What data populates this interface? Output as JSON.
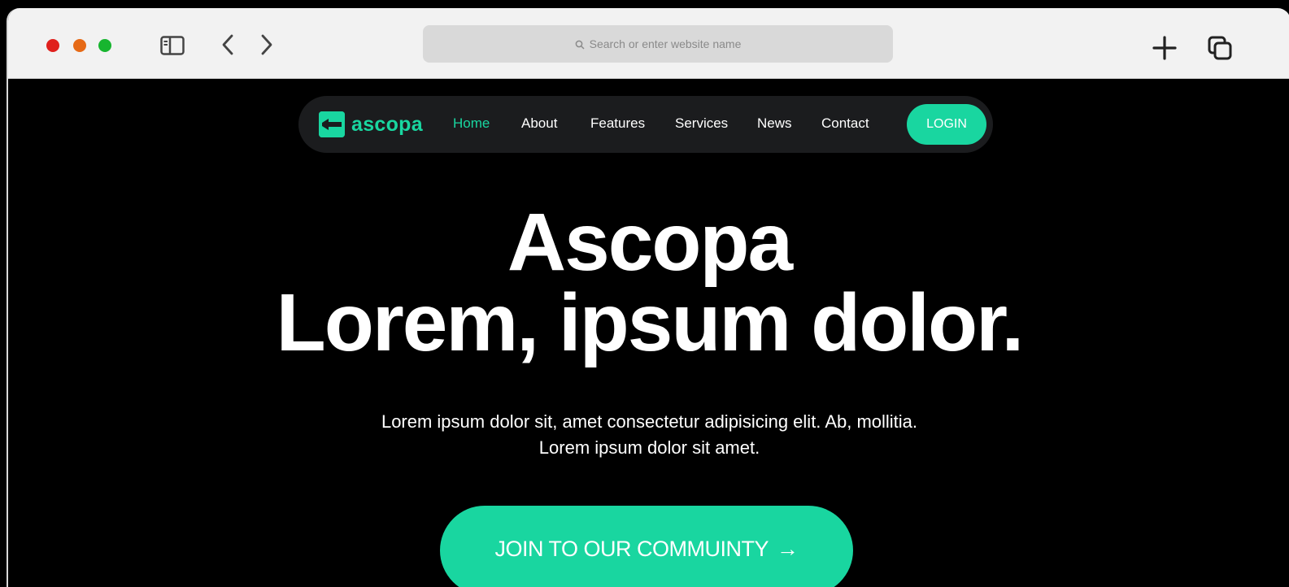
{
  "browser": {
    "address_placeholder": "Search or enter website name"
  },
  "site": {
    "logo_text": "ascopa",
    "nav": [
      "Home",
      "About",
      "Features",
      "Services",
      "News",
      "Contact"
    ],
    "active_nav": "Home",
    "login_label": "LOGIN"
  },
  "hero": {
    "title_line1": "Ascopa",
    "title_line2": "Lorem, ipsum dolor.",
    "subtitle_line1": "Lorem ipsum dolor sit, amet consectetur adipisicing elit. Ab, mollitia.",
    "subtitle_line2": "Lorem ipsum dolor sit amet.",
    "cta_label": "JOIN TO OUR COMMUINTY",
    "cta_arrow": "→"
  },
  "colors": {
    "accent": "#19d6a0",
    "page_bg": "#000000",
    "navbar_bg": "#1b1c1e",
    "chrome_bg": "#f2f2f2"
  },
  "icons": {
    "sidebar": "sidebar-icon",
    "back": "chevron-left-icon",
    "forward": "chevron-right-icon",
    "search": "search-icon",
    "new_tab": "plus-icon",
    "tabs": "tabs-overview-icon",
    "logo": "logo-icon",
    "cta": "arrow-right-icon"
  }
}
